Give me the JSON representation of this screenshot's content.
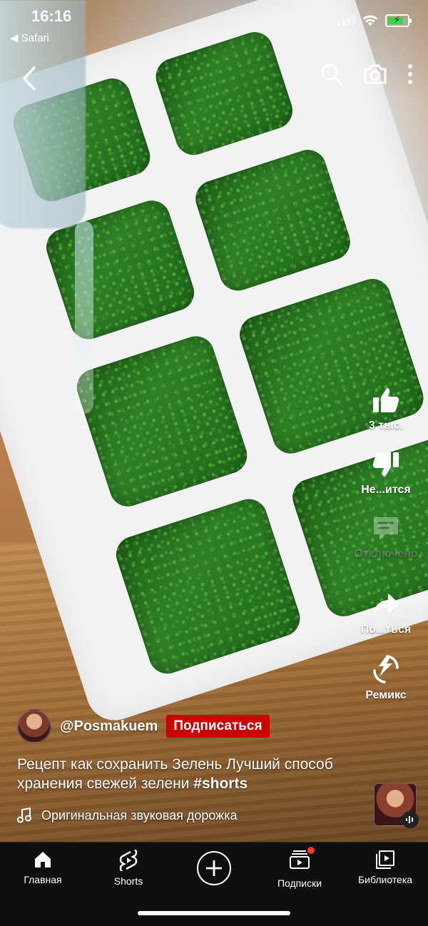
{
  "status_bar": {
    "time": "16:16",
    "back_app": "◀ Safari"
  },
  "video": {
    "likes": "3 тыс.",
    "dislike_label": "Не...ится",
    "comments_label": "Отключено",
    "share_label": "По...ться",
    "remix_label": "Ремикс"
  },
  "channel": {
    "handle": "@Posmakuem",
    "subscribe_label": "Подписаться"
  },
  "caption": {
    "text": "Рецепт как сохранить Зелень Лучший способ хранения свежей зелени ",
    "tag": "#shorts"
  },
  "sound": {
    "title": "Оригинальная звуковая дорожка"
  },
  "nav": {
    "home": "Главная",
    "shorts": "Shorts",
    "subscriptions": "Подписки",
    "library": "Библиотека"
  },
  "icons": {
    "back": "chevron-left-icon",
    "search": "search-icon",
    "camera": "camera-icon",
    "more": "more-vertical-icon",
    "like": "thumbs-up-icon",
    "dislike": "thumbs-down-icon",
    "comments": "comment-icon",
    "share": "share-icon",
    "remix": "remix-icon",
    "music": "music-note-icon",
    "create": "plus-icon"
  },
  "colors": {
    "subscribe": "#cc0000",
    "battery": "#32d74b",
    "notification": "#ff3b30"
  }
}
